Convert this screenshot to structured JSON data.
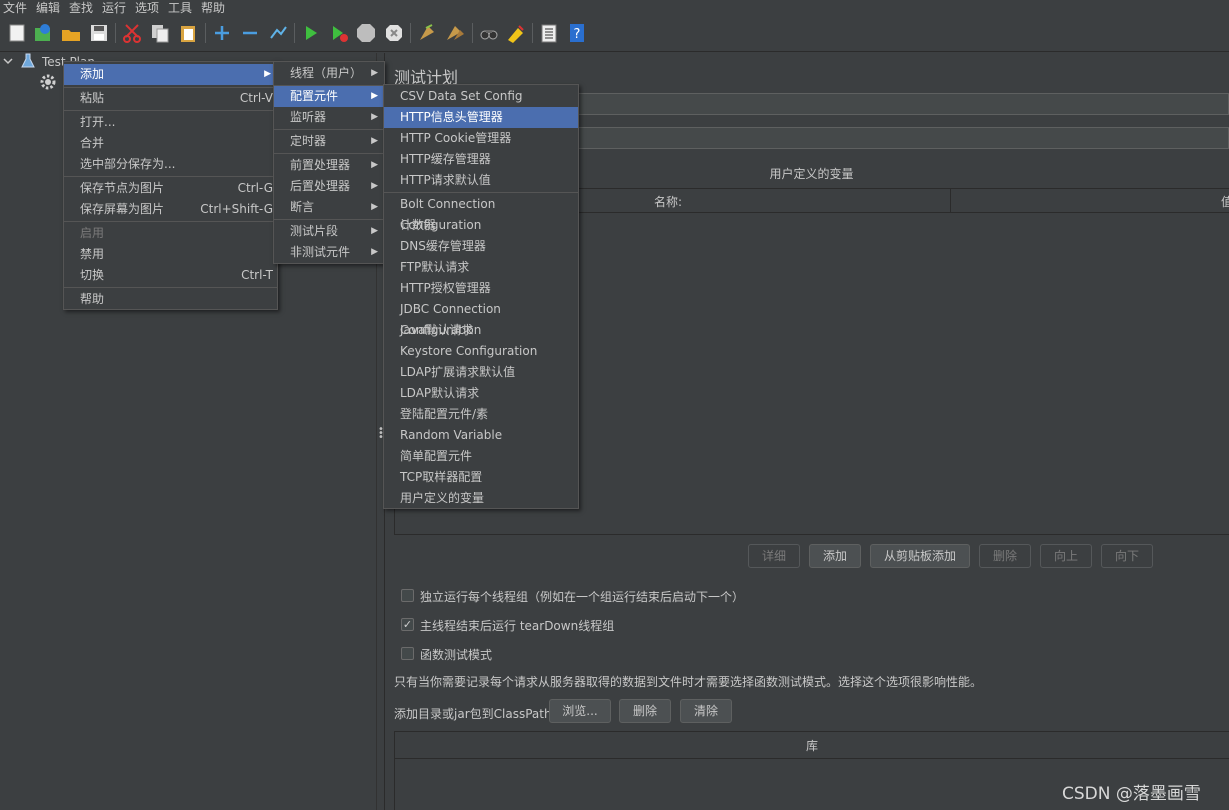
{
  "menubar": [
    "文件",
    "编辑",
    "查找",
    "运行",
    "选项",
    "工具",
    "帮助"
  ],
  "toolbar_icons": [
    "new-icon",
    "templates-icon",
    "open-icon",
    "save-icon",
    "cut-icon",
    "copy-icon",
    "paste-icon",
    "expand-icon",
    "collapse-icon",
    "toggle-icon",
    "start-icon",
    "start-no-pause-icon",
    "stop-icon",
    "shutdown-icon",
    "clear-icon",
    "clear-all-icon",
    "search-icon",
    "reset-search-icon",
    "function-helper-icon",
    "help-icon"
  ],
  "tree": {
    "root_label": "Test Plan"
  },
  "context_menu": {
    "items": [
      {
        "label": "添加",
        "shortcut": "",
        "submenu": true,
        "selected": true,
        "disabled": false
      },
      {
        "label": "粘贴",
        "shortcut": "Ctrl-V",
        "submenu": false,
        "selected": false,
        "disabled": false
      },
      {
        "label": "打开...",
        "shortcut": "",
        "submenu": false,
        "selected": false,
        "disabled": false
      },
      {
        "label": "合并",
        "shortcut": "",
        "submenu": false,
        "selected": false,
        "disabled": false
      },
      {
        "label": "选中部分保存为...",
        "shortcut": "",
        "submenu": false,
        "selected": false,
        "disabled": false
      },
      {
        "label": "保存节点为图片",
        "shortcut": "Ctrl-G",
        "submenu": false,
        "selected": false,
        "disabled": false
      },
      {
        "label": "保存屏幕为图片",
        "shortcut": "Ctrl+Shift-G",
        "submenu": false,
        "selected": false,
        "disabled": false
      },
      {
        "label": "启用",
        "shortcut": "",
        "submenu": false,
        "selected": false,
        "disabled": true
      },
      {
        "label": "禁用",
        "shortcut": "",
        "submenu": false,
        "selected": false,
        "disabled": false
      },
      {
        "label": "切换",
        "shortcut": "Ctrl-T",
        "submenu": false,
        "selected": false,
        "disabled": false
      },
      {
        "label": "帮助",
        "shortcut": "",
        "submenu": false,
        "selected": false,
        "disabled": false
      }
    ]
  },
  "add_submenu": {
    "items": [
      {
        "label": "线程（用户）",
        "selected": false
      },
      {
        "label": "配置元件",
        "selected": true
      },
      {
        "label": "监听器",
        "selected": false
      },
      {
        "label": "定时器",
        "selected": false
      },
      {
        "label": "前置处理器",
        "selected": false
      },
      {
        "label": "后置处理器",
        "selected": false
      },
      {
        "label": "断言",
        "selected": false
      },
      {
        "label": "测试片段",
        "selected": false
      },
      {
        "label": "非测试元件",
        "selected": false
      }
    ]
  },
  "config_submenu": {
    "items": [
      {
        "label": "CSV Data Set Config",
        "selected": false
      },
      {
        "label": "HTTP信息头管理器",
        "selected": true
      },
      {
        "label": "HTTP Cookie管理器",
        "selected": false
      },
      {
        "label": "HTTP缓存管理器",
        "selected": false
      },
      {
        "label": "HTTP请求默认值",
        "selected": false
      },
      {
        "label": "Bolt Connection Configuration",
        "selected": false
      },
      {
        "label": "计数器",
        "selected": false
      },
      {
        "label": "DNS缓存管理器",
        "selected": false
      },
      {
        "label": "FTP默认请求",
        "selected": false
      },
      {
        "label": "HTTP授权管理器",
        "selected": false
      },
      {
        "label": "JDBC Connection Configuration",
        "selected": false
      },
      {
        "label": "Java默认请求",
        "selected": false
      },
      {
        "label": "Keystore Configuration",
        "selected": false
      },
      {
        "label": "LDAP扩展请求默认值",
        "selected": false
      },
      {
        "label": "LDAP默认请求",
        "selected": false
      },
      {
        "label": "登陆配置元件/素",
        "selected": false
      },
      {
        "label": "Random Variable",
        "selected": false
      },
      {
        "label": "简单配置元件",
        "selected": false
      },
      {
        "label": "TCP取样器配置",
        "selected": false
      },
      {
        "label": "用户定义的变量",
        "selected": false
      }
    ]
  },
  "panel": {
    "title": "测试计划",
    "variables_title": "用户定义的变量",
    "col_name": "名称:",
    "col_value": "值",
    "buttons": {
      "detail": "详细",
      "add": "添加",
      "add_clipboard": "从剪贴板添加",
      "delete": "删除",
      "up": "向上",
      "down": "向下"
    },
    "checkboxes": [
      {
        "label": "独立运行每个线程组（例如在一个组运行结束后启动下一个）",
        "checked": false
      },
      {
        "label": "主线程结束后运行 tearDown线程组",
        "checked": true
      },
      {
        "label": "函数测试模式",
        "checked": false
      }
    ],
    "note": "只有当你需要记录每个请求从服务器取得的数据到文件时才需要选择函数测试模式。选择这个选项很影响性能。",
    "classpath_label": "添加目录或jar包到ClassPath",
    "classpath_buttons": {
      "browse": "浏览...",
      "delete": "删除",
      "clear": "清除"
    },
    "library_header": "库"
  },
  "watermark": "CSDN @落墨画雪",
  "colors": {
    "background": "#3c3f41",
    "selection": "#4b6eaf",
    "text": "#c8c8c8"
  }
}
